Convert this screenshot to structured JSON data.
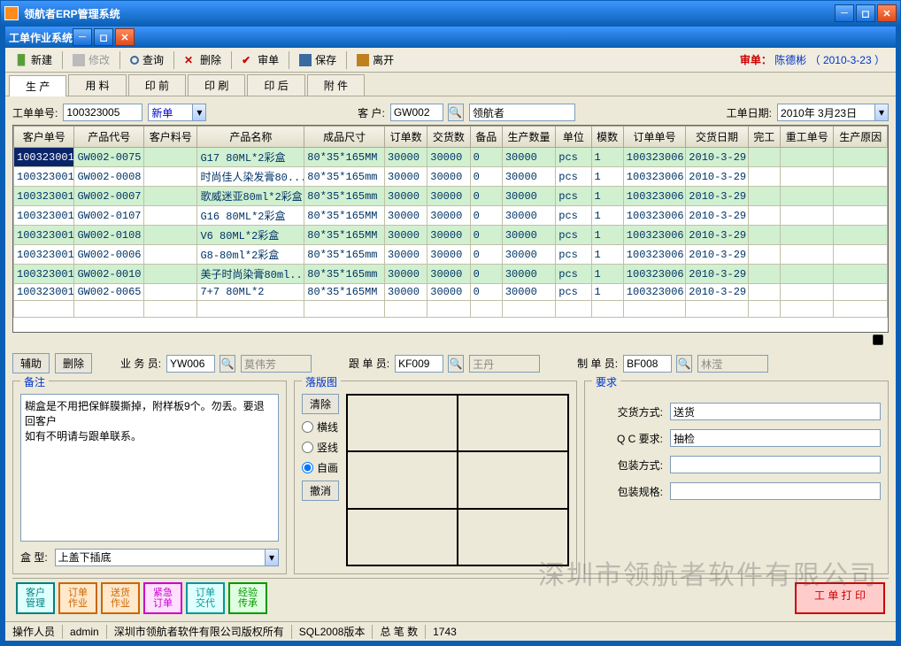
{
  "outerWindow": {
    "title": "领航者ERP管理系统"
  },
  "innerWindow": {
    "title": "工单作业系统"
  },
  "toolbar": {
    "new": "新建",
    "edit": "修改",
    "query": "查询",
    "delete": "删除",
    "audit": "审单",
    "save": "保存",
    "leave": "离开"
  },
  "auditInfo": {
    "label": "审单：",
    "name": "陈德彬",
    "date": "（ 2010-3-23 ）"
  },
  "tabs": [
    "生 产",
    "用 料",
    "印 前",
    "印 刷",
    "印 后",
    "附 件"
  ],
  "activeTab": 0,
  "header": {
    "orderNoLabel": "工单单号:",
    "orderNo": "100323005",
    "status": "新单",
    "custLabel": "客    户:",
    "custCode": "GW002",
    "custName": "领航者",
    "dateLabel": "工单日期:",
    "date": "2010年 3月23日"
  },
  "gridColumns": [
    "客户单号",
    "产品代号",
    "客户料号",
    "产品名称",
    "成品尺寸",
    "订单数",
    "交货数",
    "备品",
    "生产数量",
    "单位",
    "模数",
    "订单单号",
    "交货日期",
    "完工",
    "重工单号",
    "生产原因"
  ],
  "gridRows": [
    {
      "cust": "100323001",
      "prod": "GW002-0075",
      "mat": "",
      "name": "G17  80ML*2彩盒",
      "size": "80*35*165MM",
      "ord": "30000",
      "del": "30000",
      "sp": "0",
      "qty": "30000",
      "unit": "pcs",
      "mold": "1",
      "ordno": "100323006",
      "ddate": "2010-3-29",
      "fin": "",
      "rework": "",
      "reason": ""
    },
    {
      "cust": "100323001",
      "prod": "GW002-0008",
      "mat": "",
      "name": "时尚佳人染发膏80...",
      "size": "80*35*165mm",
      "ord": "30000",
      "del": "30000",
      "sp": "0",
      "qty": "30000",
      "unit": "pcs",
      "mold": "1",
      "ordno": "100323006",
      "ddate": "2010-3-29",
      "fin": "",
      "rework": "",
      "reason": ""
    },
    {
      "cust": "100323001",
      "prod": "GW002-0007",
      "mat": "",
      "name": "歌威迷亚80ml*2彩盒",
      "size": "80*35*165mm",
      "ord": "30000",
      "del": "30000",
      "sp": "0",
      "qty": "30000",
      "unit": "pcs",
      "mold": "1",
      "ordno": "100323006",
      "ddate": "2010-3-29",
      "fin": "",
      "rework": "",
      "reason": ""
    },
    {
      "cust": "100323001",
      "prod": "GW002-0107",
      "mat": "",
      "name": "G16  80ML*2彩盒",
      "size": "80*35*165MM",
      "ord": "30000",
      "del": "30000",
      "sp": "0",
      "qty": "30000",
      "unit": "pcs",
      "mold": "1",
      "ordno": "100323006",
      "ddate": "2010-3-29",
      "fin": "",
      "rework": "",
      "reason": ""
    },
    {
      "cust": "100323001",
      "prod": "GW002-0108",
      "mat": "",
      "name": "V6  80ML*2彩盒",
      "size": "80*35*165MM",
      "ord": "30000",
      "del": "30000",
      "sp": "0",
      "qty": "30000",
      "unit": "pcs",
      "mold": "1",
      "ordno": "100323006",
      "ddate": "2010-3-29",
      "fin": "",
      "rework": "",
      "reason": ""
    },
    {
      "cust": "100323001",
      "prod": "GW002-0006",
      "mat": "",
      "name": "G8-80ml*2彩盒",
      "size": "80*35*165mm",
      "ord": "30000",
      "del": "30000",
      "sp": "0",
      "qty": "30000",
      "unit": "pcs",
      "mold": "1",
      "ordno": "100323006",
      "ddate": "2010-3-29",
      "fin": "",
      "rework": "",
      "reason": ""
    },
    {
      "cust": "100323001",
      "prod": "GW002-0010",
      "mat": "",
      "name": "美子时尚染膏80ml...",
      "size": "80*35*165mm",
      "ord": "30000",
      "del": "30000",
      "sp": "0",
      "qty": "30000",
      "unit": "pcs",
      "mold": "1",
      "ordno": "100323006",
      "ddate": "2010-3-29",
      "fin": "",
      "rework": "",
      "reason": ""
    },
    {
      "cust": "100323001",
      "prod": "GW002-0065",
      "mat": "",
      "name": "7+7  80ML*2",
      "size": "80*35*165MM",
      "ord": "30000",
      "del": "30000",
      "sp": "0",
      "qty": "30000",
      "unit": "pcs",
      "mold": "1",
      "ordno": "100323006",
      "ddate": "2010-3-29",
      "fin": "",
      "rework": "",
      "reason": ""
    }
  ],
  "midRow": {
    "aux": "辅助",
    "del": "删除",
    "salesLabel": "业 务 员:",
    "salesCode": "YW006",
    "salesName": "莫伟芳",
    "followLabel": "跟 单 员:",
    "followCode": "KF009",
    "followName": "王丹",
    "makerLabel": "制 单 员:",
    "makerCode": "BF008",
    "makerName": "林滢"
  },
  "remark": {
    "title": "备注",
    "text": "糊盒是不用把保鲜膜撕掉，附样板9个。勿丢。要退回客户\n如有不明请与跟单联系。",
    "boxTypeLabel": "盒    型:",
    "boxType": "上盖下插底"
  },
  "layout": {
    "title": "落版图",
    "clear": "清除",
    "hline": "横线",
    "vline": "竖线",
    "free": "自画",
    "undo": "撤消",
    "selected": "free"
  },
  "req": {
    "title": "要求",
    "deliveryLabel": "交货方式:",
    "delivery": "送货",
    "qcLabel": "Q C 要求:",
    "qc": "抽检",
    "packLabel": "包装方式:",
    "pack": "",
    "specLabel": "包装规格:",
    "spec": ""
  },
  "bottomBtns": {
    "b1": "客户\n管理",
    "b2": "订单\n作业",
    "b3": "送货\n作业",
    "b4": "紧急\n订单",
    "b5": "订单\n交代",
    "b6": "经验\n传承",
    "print": "工 单 打 印"
  },
  "status": {
    "opLabel": "操作人员",
    "op": "admin",
    "copyright": "深圳市领航者软件有限公司版权所有",
    "ver": "SQL2008版本",
    "totalLabel": "总    笔    数",
    "total": "1743"
  },
  "watermark": "深圳市领航者软件有限公司"
}
